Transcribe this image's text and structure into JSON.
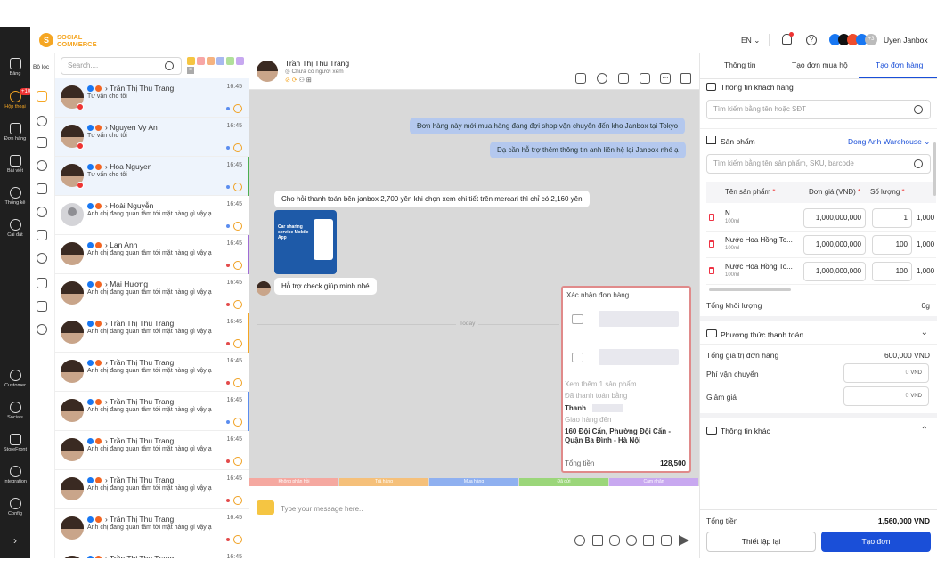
{
  "brand": {
    "line1": "SOCIAL",
    "line2": "COMMERCE",
    "color": "#f5a623"
  },
  "topbar": {
    "lang": "EN",
    "user_name": "Uyen Janbox",
    "extra_count": "+3"
  },
  "leftnav": {
    "items": [
      {
        "label": "Bảng",
        "icon": "dashboard-icon"
      },
      {
        "label": "Hộp thoại",
        "icon": "chat-icon",
        "badge": "+10",
        "active": true
      },
      {
        "label": "Đơn hàng",
        "icon": "order-icon"
      },
      {
        "label": "Bài viết",
        "icon": "post-icon"
      },
      {
        "label": "Thống kê",
        "icon": "stats-icon"
      },
      {
        "label": "Cài đặt",
        "icon": "settings-icon"
      },
      {
        "label": "Customer",
        "icon": "customer-icon"
      },
      {
        "label": "Socials",
        "icon": "socials-icon"
      },
      {
        "label": "StoreFront",
        "icon": "storefront-icon"
      },
      {
        "label": "Integration",
        "icon": "integration-icon"
      },
      {
        "label": "Config",
        "icon": "config-icon"
      }
    ]
  },
  "filter": {
    "label": "Bộ lọc"
  },
  "search": {
    "placeholder": "Search...."
  },
  "tag_colors": [
    "#f5c542",
    "#f7a6a6",
    "#f5b380",
    "#a8b8f0",
    "#b0e09a",
    "#c7a8f0"
  ],
  "conversations": [
    {
      "name": "Trần Thị Thu Trang",
      "time": "16:45",
      "msg": "Tư vấn cho tôi",
      "highlight": true,
      "dot": "#5b8def",
      "bar": ""
    },
    {
      "name": "Nguyen Vy An",
      "time": "16:45",
      "msg": "Tư vấn cho tôi",
      "highlight": true,
      "dot": "#5b8def",
      "bar": ""
    },
    {
      "name": "Hoa Nguyen",
      "time": "16:45",
      "msg": "Tư vấn cho tôi",
      "highlight": true,
      "dot": "#5b8def",
      "bar": "#4caf50"
    },
    {
      "name": "Hoài Nguyễn",
      "time": "16:45",
      "msg": "Anh chị đang quan tâm tới mặt hàng gì vậy ạ",
      "highlight": false,
      "dot": "#5b8def",
      "bar": ""
    },
    {
      "name": "Lan Anh",
      "time": "16:45",
      "msg": "Anh chị đang quan tâm tới mặt hàng gì vậy ạ",
      "highlight": false,
      "dot": "#e34b4b",
      "bar": "#a06cd5"
    },
    {
      "name": "Mai Hương",
      "time": "16:45",
      "msg": "Anh chị đang quan tâm tới mặt hàng gì vậy ạ",
      "highlight": false,
      "dot": "#e34b4b",
      "bar": ""
    },
    {
      "name": "Trần Thị Thu Trang",
      "time": "16:45",
      "msg": "Anh chị đang quan tâm tới mặt hàng gì vậy ạ",
      "highlight": false,
      "dot": "#e34b4b",
      "bar": "#f5a623"
    },
    {
      "name": "Trần Thị Thu Trang",
      "time": "16:45",
      "msg": "Anh chị đang quan tâm tới mặt hàng gì vậy ạ",
      "highlight": false,
      "dot": "#e34b4b",
      "bar": ""
    },
    {
      "name": "Trần Thị Thu Trang",
      "time": "16:45",
      "msg": "Anh chị đang quan tâm tới mặt hàng gì vậy ạ",
      "highlight": false,
      "dot": "#5b8def",
      "bar": "#5b8def"
    },
    {
      "name": "Trần Thị Thu Trang",
      "time": "16:45",
      "msg": "Anh chị đang quan tâm tới mặt hàng gì vậy ạ",
      "highlight": false,
      "dot": "#e34b4b",
      "bar": ""
    },
    {
      "name": "Trần Thị Thu Trang",
      "time": "16:45",
      "msg": "Anh chị đang quan tâm tới mặt hàng gì vậy ạ",
      "highlight": false,
      "dot": "#e34b4b",
      "bar": ""
    },
    {
      "name": "Trần Thị Thu Trang",
      "time": "16:45",
      "msg": "Anh chị đang quan tâm tới mặt hàng gì vậy ạ",
      "highlight": false,
      "dot": "#e34b4b",
      "bar": ""
    },
    {
      "name": "Trần Thị Thu Trang",
      "time": "16:45",
      "msg": "",
      "highlight": false,
      "dot": "",
      "bar": ""
    }
  ],
  "chat": {
    "contact_name": "Trần Thị Thu Trang",
    "contact_sub": "Chưa có người xem",
    "messages": {
      "out1": "Đơn hàng này mới mua hàng đang đợi shop vận chuyển đến kho Janbox tại Tokyo",
      "out2": "Dạ cần hỗ trợ thêm thông tin anh liên hệ lại Janbox nhé ạ",
      "in1": "Cho hỏi thanh toán bên janbox 2,700 yên khi chọn xem chi tiết trên mercari thì chỉ có 2,160 yên",
      "img_text": "Car sharing service Mobile App",
      "in2": "Hỗ trợ check giúp mình nhé",
      "divider": "Today"
    },
    "order_card": {
      "title": "Xác nhận đơn hàng",
      "more": "Xem thêm 1 sản phẩm",
      "paid": "Đã thanh toán bằng",
      "payer": "Thanh",
      "ship": "Giao hàng đến",
      "address": "160 Đội Cấn, Phường Đội Cấn - Quận Ba Đình - Hà Nội",
      "total_label": "Tổng tiền",
      "total": "128,500"
    },
    "tags": [
      {
        "label": "Không phản hồi",
        "color": "#f5a8a0"
      },
      {
        "label": "Trả hàng",
        "color": "#f5c07a"
      },
      {
        "label": "Mua hàng",
        "color": "#8fb0f0"
      },
      {
        "label": "Đã gửi",
        "color": "#9bd67a"
      },
      {
        "label": "Cảm nhận",
        "color": "#c8a8f0"
      }
    ],
    "composer_placeholder": "Type your message here.."
  },
  "right": {
    "tabs": [
      "Thông tin",
      "Tạo đơn mua hộ",
      "Tạo đơn hàng"
    ],
    "active_tab": 2,
    "customer_title": "Thông tin khách hàng",
    "customer_search": "Tìm kiếm bằng tên hoặc SĐT",
    "product_title": "Sản phẩm",
    "warehouse": "Dong Anh Warehouse",
    "product_search": "Tìm kiếm bằng tên sản phẩm, SKU, barcode",
    "col_name": "Tên sản phẩm",
    "col_price": "Đơn giá (VNĐ)",
    "col_qty": "Số lượng",
    "products": [
      {
        "name": "N...",
        "sub": "100ml",
        "price": "1,000,000,000",
        "qty": "1",
        "total": "1,000"
      },
      {
        "name": "Nước Hoa Hồng To...",
        "sub": "100ml",
        "price": "1,000,000,000",
        "qty": "100",
        "total": "1,000"
      },
      {
        "name": "Nước Hoa Hồng To...",
        "sub": "100ml",
        "price": "1,000,000,000",
        "qty": "100",
        "total": "1,000"
      }
    ],
    "weight_label": "Tổng khối lượng",
    "weight": "0g",
    "payment_title": "Phương thức thanh toán",
    "order_value_label": "Tổng giá trị đơn hàng",
    "order_value": "600,000 VND",
    "ship_label": "Phí vận chuyển",
    "ship_value": "0",
    "discount_label": "Giảm giá",
    "discount_value": "0",
    "currency": "VND",
    "other_title": "Thông tin khác",
    "total_label": "Tổng tiền",
    "total": "1,560,000 VND",
    "reset_button": "Thiết lập lại",
    "create_button": "Tạo đơn"
  }
}
